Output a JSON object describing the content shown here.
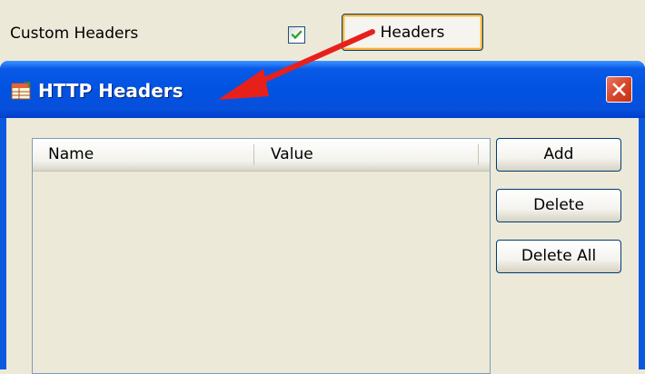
{
  "form": {
    "custom_headers_label": "Custom Headers",
    "custom_headers_checked": true,
    "headers_button_label": "Headers"
  },
  "dialog": {
    "title": "HTTP Headers",
    "table": {
      "columns": [
        "Name",
        "Value"
      ],
      "rows": []
    },
    "buttons": {
      "add": "Add",
      "delete": "Delete",
      "delete_all": "Delete All"
    }
  },
  "annotation": {
    "arrow_color": "#e8201c"
  },
  "theme": {
    "titlebar_blue": "#0052e0",
    "close_red": "#d5442a",
    "window_background": "#ece9d8",
    "focus_orange": "#f8b33b"
  }
}
